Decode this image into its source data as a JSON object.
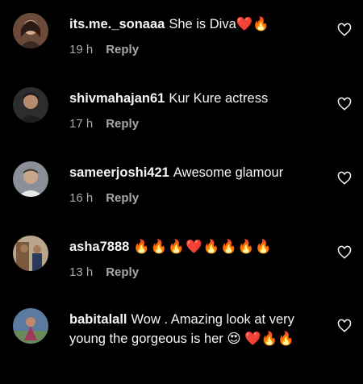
{
  "comments": [
    {
      "username": "its.me._sonaaa",
      "text": "She is Diva❤️🔥",
      "time": "19 h",
      "reply": "Reply"
    },
    {
      "username": "shivmahajan61",
      "text": "Kur Kure actress",
      "time": "17 h",
      "reply": "Reply"
    },
    {
      "username": "sameerjoshi421",
      "text": "Awesome glamour",
      "time": "16 h",
      "reply": "Reply"
    },
    {
      "username": "asha7888",
      "text": "🔥🔥🔥❤️🔥🔥🔥🔥",
      "time": "13 h",
      "reply": "Reply"
    },
    {
      "username": "babitalall",
      "text": "Wow . Amazing look at very young the gorgeous is her 😍 ❤️🔥🔥",
      "time": "",
      "reply": ""
    }
  ],
  "icons": {
    "like": "heart-outline-icon"
  },
  "colors": {
    "background": "#000000",
    "text": "#f5f5f5",
    "meta": "#a8a8a8"
  }
}
